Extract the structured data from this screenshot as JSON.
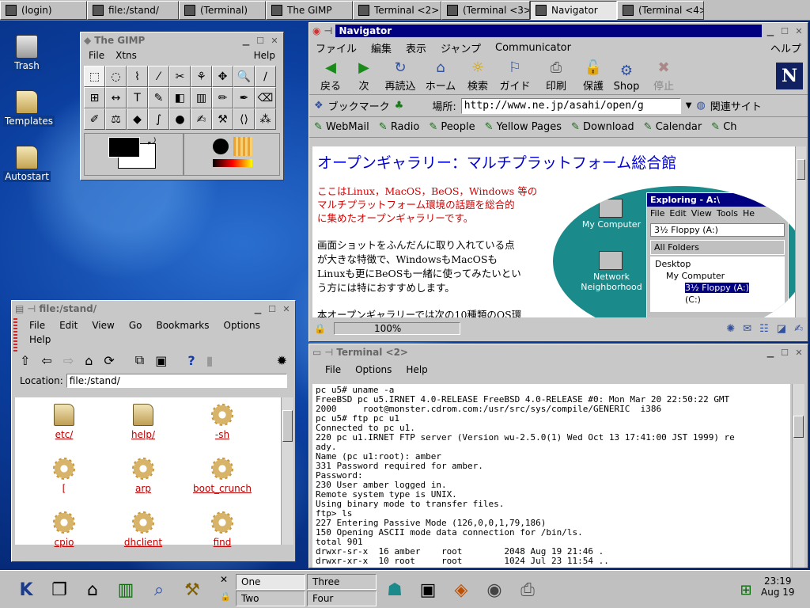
{
  "top_tasks": [
    "(login)",
    "file:/stand/",
    "(Terminal)",
    "The GIMP",
    "Terminal <2>",
    "(Terminal <3>",
    "Navigator",
    "(Terminal <4>"
  ],
  "desktop_icons": [
    "Trash",
    "Templates",
    "Autostart"
  ],
  "gimp": {
    "title": "The GIMP",
    "menu": [
      "File",
      "Xtns",
      "Help"
    ],
    "tools": [
      "⬚",
      "◌",
      "⌇",
      "⁄",
      "✂",
      "⚘",
      "✥",
      "🔍",
      "∕",
      "⊞",
      "↔",
      "T",
      "✎",
      "◧",
      "▥",
      "✏",
      "✒",
      "⌫",
      "✐",
      "⚖",
      "◆",
      "∫",
      "●",
      "✍",
      "⚒",
      "⟨⟩",
      "⁂"
    ]
  },
  "navigator": {
    "title": "Navigator",
    "menu": [
      "ファイル",
      "編集",
      "表示",
      "ジャンプ",
      "Communicator"
    ],
    "help": "ヘルプ",
    "toolbar": [
      "戻る",
      "次",
      "再読込",
      "ホーム",
      "検索",
      "ガイド",
      "印刷",
      "保護",
      "Shop",
      "停止"
    ],
    "bookmark_label": "ブックマーク",
    "location_label": "場所:",
    "url": "http://www.ne.jp/asahi/open/g",
    "related": "関連サイト",
    "personal": [
      "WebMail",
      "Radio",
      "People",
      "Yellow Pages",
      "Download",
      "Calendar",
      "Ch"
    ],
    "page_title": "オープンギャラリー：マルチプラットフォーム総合館",
    "intro_red": [
      "ここはLinux，MacOS，BeOS，Windows 等の",
      "マルチプラットフォーム環境の話題を総合的",
      "に集めたオープンギャラリーです。"
    ],
    "intro_black": [
      "画面ショットをふんだんに取り入れている点",
      "が大きな特徴で、WindowsもMacOSも",
      "Linuxも更にBeOSも一緒に使ってみたいとい",
      "う方には特におすすめします。"
    ],
    "intro_more": "本オープンギャラリーでは次の10種類のOS環",
    "explorer": {
      "title": "Exploring - A:\\",
      "menu": [
        "File",
        "Edit",
        "View",
        "Tools",
        "He"
      ],
      "drive": "3½ Floppy (A:)",
      "all_folders": "All Folders",
      "tree": [
        "Desktop",
        "My Computer",
        "3½ Floppy (A:)",
        "(C:)"
      ],
      "side_icons": [
        "My Computer",
        "Network Neighborhood"
      ]
    },
    "zoom": "100%"
  },
  "konqueror": {
    "title": "file:/stand/",
    "menu": [
      "File",
      "Edit",
      "View",
      "Go",
      "Bookmarks",
      "Options"
    ],
    "menu2": "Help",
    "location_label": "Location:",
    "location": "file:/stand/",
    "files": [
      {
        "name": "etc/",
        "kind": "folder"
      },
      {
        "name": "help/",
        "kind": "folder"
      },
      {
        "name": "-sh",
        "kind": "exec"
      },
      {
        "name": "[",
        "kind": "exec"
      },
      {
        "name": "arp",
        "kind": "exec"
      },
      {
        "name": "boot_crunch",
        "kind": "exec"
      },
      {
        "name": "cpio",
        "kind": "exec"
      },
      {
        "name": "dhclient",
        "kind": "exec"
      },
      {
        "name": "find",
        "kind": "exec"
      }
    ]
  },
  "terminal": {
    "title": "Terminal <2>",
    "menu": [
      "File",
      "Options",
      "Help"
    ],
    "lines": [
      "pc u5# uname -a",
      "FreeBSD pc u5.IRNET 4.0-RELEASE FreeBSD 4.0-RELEASE #0: Mon Mar 20 22:50:22 GMT",
      "2000     root@monster.cdrom.com:/usr/src/sys/compile/GENERIC  i386",
      "pc u5# ftp pc u1",
      "Connected to pc u1.",
      "220 pc u1.IRNET FTP server (Version wu-2.5.0(1) Wed Oct 13 17:41:00 JST 1999) re",
      "ady.",
      "Name (pc u1:root): amber",
      "331 Password required for amber.",
      "Password:",
      "230 User amber logged in.",
      "Remote system type is UNIX.",
      "Using binary mode to transfer files.",
      "ftp> ls",
      "227 Entering Passive Mode (126,0,0,1,79,186)",
      "150 Opening ASCII mode data connection for /bin/ls.",
      "total 901",
      "drwxr-sr-x  16 amber    root        2048 Aug 19 21:46 .",
      "drwxr-xr-x  10 root     root        1024 Jul 23 11:54 .."
    ]
  },
  "panel": {
    "desktops": [
      "One",
      "Two",
      "Three",
      "Four"
    ],
    "time": "23:19",
    "date": "Aug 19"
  }
}
